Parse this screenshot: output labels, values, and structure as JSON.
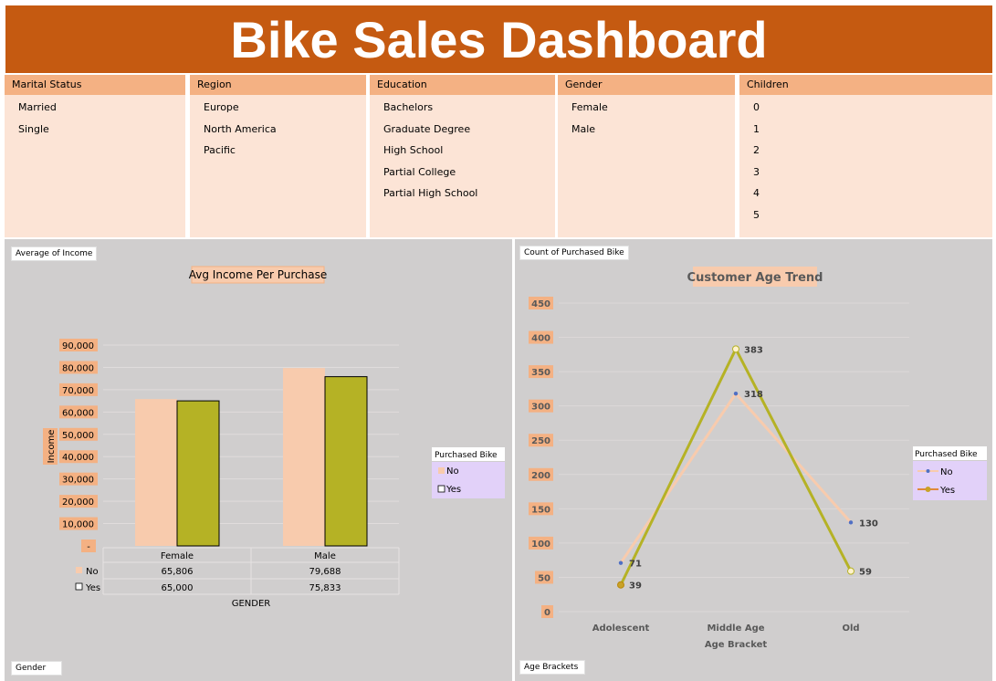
{
  "title": "Bike Sales Dashboard",
  "slicers": [
    {
      "header": "Marital Status",
      "items": [
        "Married",
        "Single"
      ]
    },
    {
      "header": "Region",
      "items": [
        "Europe",
        "North America",
        "Pacific"
      ]
    },
    {
      "header": "Education",
      "items": [
        "Bachelors",
        "Graduate Degree",
        "High School",
        "Partial College",
        "Partial High School"
      ]
    },
    {
      "header": "Gender",
      "items": [
        "Female",
        "Male"
      ]
    },
    {
      "header": "Children",
      "items": [
        "0",
        "1",
        "2",
        "3",
        "4",
        "5"
      ]
    }
  ],
  "colors": {
    "header_bg": "#c55a11",
    "slicer_header": "#f4b183",
    "slicer_body": "#fce4d6",
    "panel_bg": "#d0cece",
    "no_series": "#f8cbad",
    "yes_series": "#b5b225",
    "legend_bg": "#e2d1f9"
  },
  "left_panel": {
    "value_field": "Average of Income",
    "axis_field": "Gender"
  },
  "right_panel": {
    "value_field": "Count of Purchased Bike",
    "axis_field": "Age Brackets"
  },
  "chart_data": [
    {
      "type": "bar",
      "title": "Avg Income Per Purchase",
      "xlabel": "GENDER",
      "ylabel": "Income",
      "categories": [
        "Female",
        "Male"
      ],
      "series": [
        {
          "name": "No",
          "values": [
            65806,
            79688
          ],
          "labels": [
            "65,806",
            "79,688"
          ]
        },
        {
          "name": "Yes",
          "values": [
            65000,
            75833
          ],
          "labels": [
            "65,000",
            "75,833"
          ]
        }
      ],
      "ylim": [
        0,
        90000
      ],
      "yticks": [
        0,
        10000,
        20000,
        30000,
        40000,
        50000,
        60000,
        70000,
        80000,
        90000
      ],
      "ytick_labels": [
        "-",
        "10,000",
        "20,000",
        "30,000",
        "40,000",
        "50,000",
        "60,000",
        "70,000",
        "80,000",
        "90,000"
      ],
      "legend_title": "Purchased Bike",
      "legend_position": "right",
      "data_table": true,
      "grid": true
    },
    {
      "type": "line",
      "title": "Customer Age Trend",
      "xlabel": "Age Bracket",
      "categories": [
        "Adolescent",
        "Middle Age",
        "Old"
      ],
      "series": [
        {
          "name": "No",
          "values": [
            71,
            318,
            130
          ]
        },
        {
          "name": "Yes",
          "values": [
            39,
            383,
            59
          ]
        }
      ],
      "ylim": [
        0,
        450
      ],
      "yticks": [
        0,
        50,
        100,
        150,
        200,
        250,
        300,
        350,
        400,
        450
      ],
      "ytick_labels": [
        "0",
        "50",
        "100",
        "150",
        "200",
        "250",
        "300",
        "350",
        "400",
        "450"
      ],
      "legend_title": "Purchased Bike",
      "legend_position": "right",
      "grid": true
    }
  ]
}
